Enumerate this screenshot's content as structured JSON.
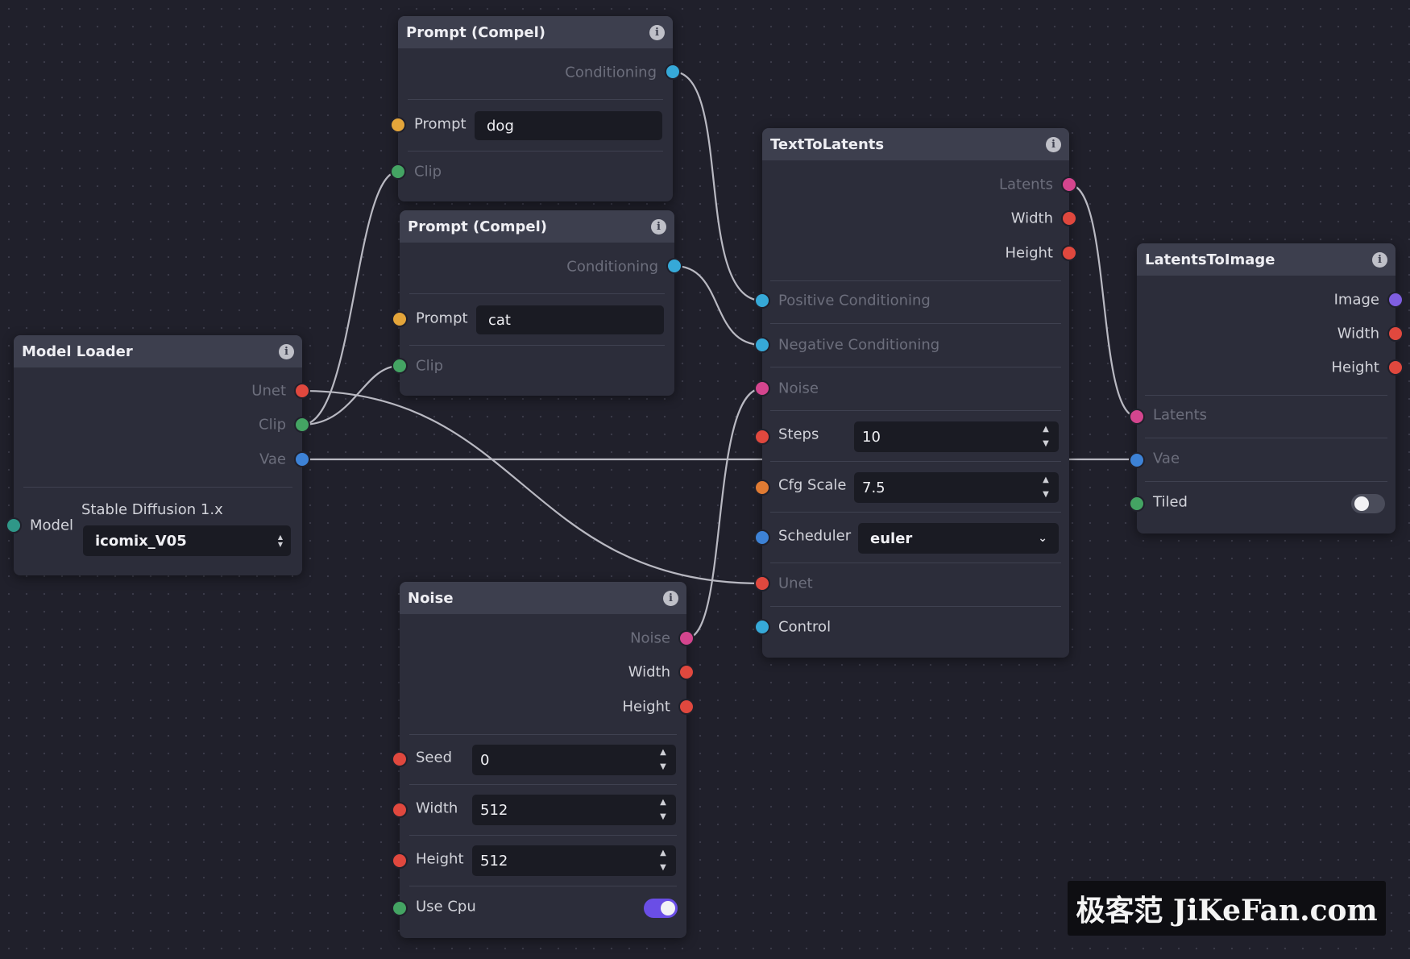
{
  "nodes": {
    "prompt1": {
      "title": "Prompt (Compel)",
      "output_conditioning": "Conditioning",
      "prompt_label": "Prompt",
      "prompt_value": "dog",
      "clip_label": "Clip"
    },
    "prompt2": {
      "title": "Prompt (Compel)",
      "output_conditioning": "Conditioning",
      "prompt_label": "Prompt",
      "prompt_value": "cat",
      "clip_label": "Clip"
    },
    "model_loader": {
      "title": "Model Loader",
      "outputs": [
        "Unet",
        "Clip",
        "Vae"
      ],
      "model_label": "Model",
      "model_caption": "Stable Diffusion 1.x",
      "model_value": "icomix_V05"
    },
    "noise": {
      "title": "Noise",
      "outputs": [
        "Noise",
        "Width",
        "Height"
      ],
      "seed_label": "Seed",
      "seed_value": "0",
      "width_label": "Width",
      "width_value": "512",
      "height_label": "Height",
      "height_value": "512",
      "use_cpu_label": "Use Cpu",
      "use_cpu": true
    },
    "text_to_latents": {
      "title": "TextToLatents",
      "outputs": [
        "Latents",
        "Width",
        "Height"
      ],
      "positive_label": "Positive Conditioning",
      "negative_label": "Negative Conditioning",
      "noise_label": "Noise",
      "steps_label": "Steps",
      "steps_value": "10",
      "cfg_label": "Cfg Scale",
      "cfg_value": "7.5",
      "scheduler_label": "Scheduler",
      "scheduler_value": "euler",
      "unet_label": "Unet",
      "control_label": "Control"
    },
    "latents_to_image": {
      "title": "LatentsToImage",
      "outputs": [
        "Image",
        "Width",
        "Height"
      ],
      "latents_label": "Latents",
      "vae_label": "Vae",
      "tiled_label": "Tiled",
      "tiled": false
    }
  },
  "icons": {
    "info": "i",
    "stepper_up": "▲",
    "stepper_down": "▼",
    "chevron_down": "⌄"
  },
  "colors": {
    "canvas": "#20202b",
    "node_body": "#2c2d3a",
    "node_header": "#3d3f4e",
    "edge": "#b9b9c2",
    "handle_red": "#e0483e",
    "handle_green": "#44a463",
    "handle_blue": "#3d82d6",
    "handle_cyan": "#36a9d8",
    "handle_yellow": "#e4a53a",
    "handle_pink": "#d4458e",
    "handle_orange": "#e07b33",
    "handle_teal": "#2f9788",
    "handle_purple": "#7f5ee0",
    "toggle_on": "#6a4ee6"
  },
  "watermark": "极客范 JiKeFan.com"
}
